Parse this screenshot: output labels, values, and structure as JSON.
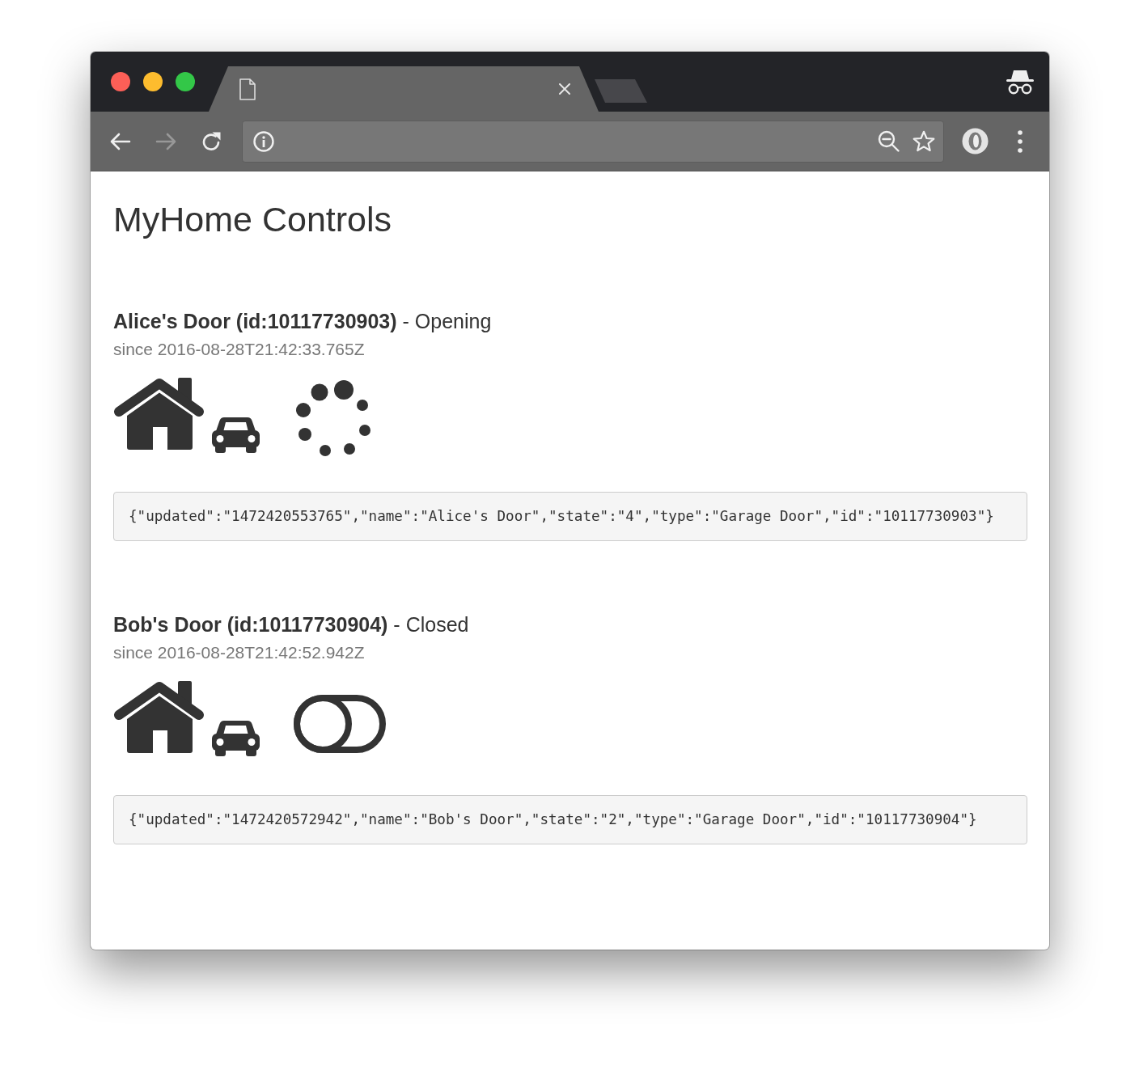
{
  "browser": {
    "navigation": [
      {
        "kind": "back",
        "disabled": false
      },
      {
        "kind": "forward",
        "disabled": true
      },
      {
        "kind": "reload",
        "disabled": false
      }
    ]
  },
  "page": {
    "title": "MyHome Controls"
  },
  "devices": [
    {
      "heading": "**Alice's Door (id:10117730903)** - Opening",
      "since": "since 2016-08-28T21:42:33.765Z",
      "kind": "opening",
      "raw": "{\"updated\":\"1472420553765\",\"name\":\"Alice's Door\",\"state\":\"4\",\"type\":\"Garage Door\",\"id\":\"10117730903\"}"
    },
    {
      "heading": "**Bob's Door (id:10117730904)** - Closed",
      "since": "since 2016-08-28T21:42:52.942Z",
      "kind": "closed",
      "raw": "{\"updated\":\"1472420572942\",\"name\":\"Bob's Door\",\"state\":\"2\",\"type\":\"Garage Door\",\"id\":\"10117730904\"}"
    }
  ]
}
